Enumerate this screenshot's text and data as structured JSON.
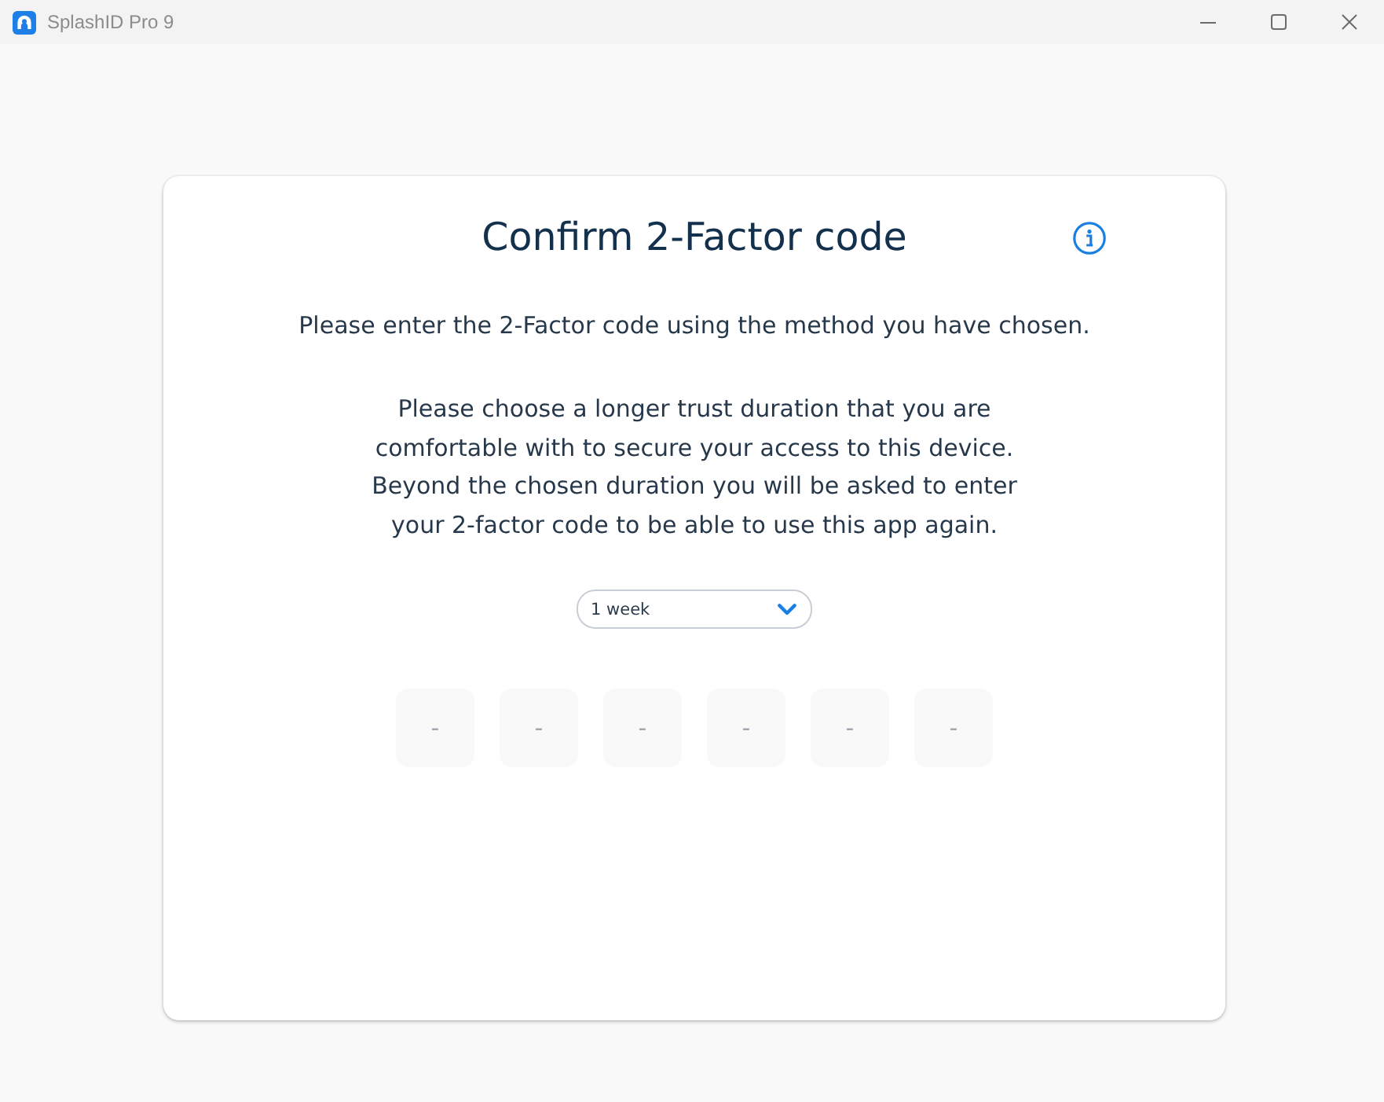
{
  "window": {
    "title": "SplashID Pro 9"
  },
  "card": {
    "title": "Confirm 2-Factor code",
    "subtitle": "Please enter the 2-Factor code using the method you have chosen.",
    "instructions": "Please choose a longer trust duration that you are comfortable with to secure your access to this device. Beyond the chosen duration you will be asked to enter your 2-factor code to be able to use this app again.",
    "trust_duration": {
      "value": "1 week"
    },
    "code_fields": [
      {
        "placeholder": "-"
      },
      {
        "placeholder": "-"
      },
      {
        "placeholder": "-"
      },
      {
        "placeholder": "-"
      },
      {
        "placeholder": "-"
      },
      {
        "placeholder": "-"
      }
    ]
  }
}
